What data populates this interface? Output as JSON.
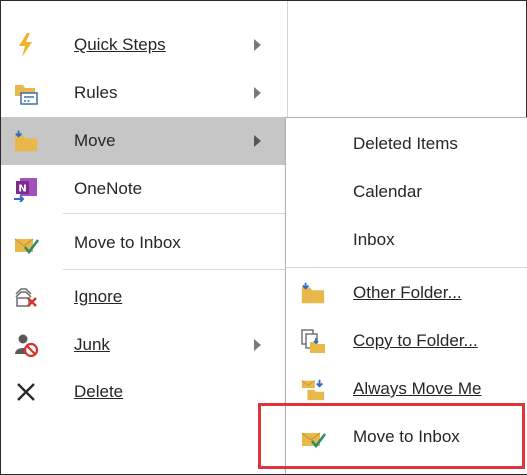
{
  "main_menu": {
    "items": [
      {
        "label": "Quick Steps",
        "icon": "lightning-icon",
        "submenu": true
      },
      {
        "label": "Rules",
        "icon": "rules-icon",
        "submenu": true
      },
      {
        "label": "Move",
        "icon": "move-folder-icon",
        "submenu": true,
        "highlighted": true
      },
      {
        "label": "OneNote",
        "icon": "onenote-icon",
        "submenu": false
      },
      {
        "label": "Move to Inbox",
        "icon": "move-to-inbox-icon",
        "submenu": false
      },
      {
        "label": "Ignore",
        "icon": "ignore-icon",
        "submenu": false
      },
      {
        "label": "Junk",
        "icon": "junk-icon",
        "submenu": true
      },
      {
        "label": "Delete",
        "icon": "delete-x-icon",
        "submenu": false
      }
    ]
  },
  "move_submenu": {
    "recent_folders": [
      "Deleted Items",
      "Calendar",
      "Inbox"
    ],
    "actions": [
      {
        "label": "Other Folder...",
        "icon": "other-folder-icon"
      },
      {
        "label": "Copy to Folder...",
        "icon": "copy-to-folder-icon"
      },
      {
        "label": "Always Move Me",
        "icon": "always-move-icon"
      },
      {
        "label": "Move to Inbox",
        "icon": "move-to-inbox-icon"
      }
    ]
  },
  "colors": {
    "highlight": "#c6c6c6",
    "annotation_box": "#e0343a",
    "folder_yellow": "#e9b84a",
    "onenote_purple": "#7a2c8c"
  }
}
